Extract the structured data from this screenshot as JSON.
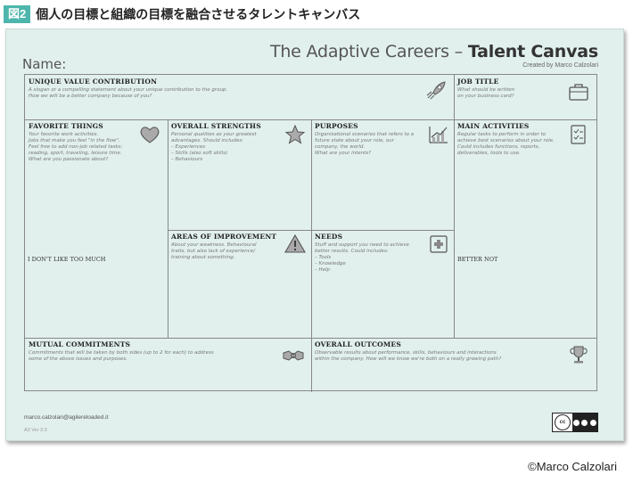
{
  "figure": {
    "badge": "図2",
    "title": "個人の目標と組織の目標を融合させるタレントキャンバス"
  },
  "canvas": {
    "name_label": "Name:",
    "brand_prefix": "The Adaptive Careers – ",
    "brand_bold": "Talent Canvas",
    "brand_sub": "Created by Marco Calzolari",
    "cells": {
      "uvc": {
        "title": "Unique Value Contribution",
        "desc": "A slogan or a compelling statement about your unique contribution to the group.\nHow we will be a better company because of you?"
      },
      "job": {
        "title": "Job Title",
        "desc": "What should be written\non your business card?"
      },
      "favorite": {
        "title": "Favorite Things",
        "desc": "Your favorite work activities.\nJobs that make you feel \"in the flow\".\nFeel free to add non-job related tasks:\nreading, sport, traveling, leisure time.\nWhat are you passionate about?"
      },
      "strengths": {
        "title": "Overall Strengths",
        "desc": "Personal qualities as your greatest\nadvantages. Should includes:\n– Experiences\n– Skills (also soft skills)\n– Behaviours"
      },
      "purposes": {
        "title": "Purposes",
        "desc": "Organisational scenarios that refers to a\nfuture state about your role, our\ncompany, the world.\nWhat are your intents?"
      },
      "activities": {
        "title": "Main Activities",
        "desc": "Regular tasks to perform in order to\nachieve best scenarios about your role.\nCould includes functions, reports,\ndeliverables, tools to use."
      },
      "improvement": {
        "title": "Areas of Improvement",
        "desc": "About your weakness. Behavioural\ntraits, but also lack of experience/\ntraining about something."
      },
      "needs": {
        "title": "Needs",
        "desc": "Stuff and support you need to achieve\nbetter results. Could includes:\n– Tools\n– Knowledge\n– Help"
      },
      "commitments": {
        "title": "Mutual Commitments",
        "desc": "Commitments that will be taken by both sides (up to 2 for each) to address\nsome of the above issues and purposes."
      },
      "outcomes": {
        "title": "Overall Outcomes",
        "desc": "Observable results about performance, skills, behaviours and interactions\nwithin the company. How will we know we're both on a really growing path?"
      }
    },
    "dont_like": "I don't like too much",
    "better_not": "Better not",
    "email": "marco.calzolari@agilereloaded.it",
    "version": "A3 Ver 3.0",
    "license_badge": "cc"
  },
  "copyright": "©Marco Calzolari"
}
